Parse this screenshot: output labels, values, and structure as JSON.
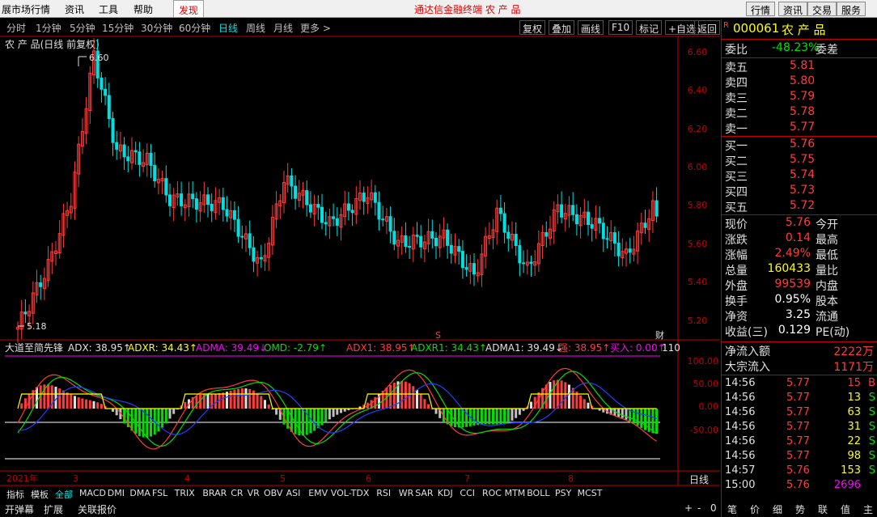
{
  "menu": [
    "展市场行情",
    "资讯",
    "工具",
    "帮助",
    "发现"
  ],
  "center_title": "通达信金融终端   农 产 品",
  "right_buttons": [
    "行情",
    "资讯",
    "交易",
    "服务"
  ],
  "periods": [
    "分时",
    "1分钟",
    "5分钟",
    "15分钟",
    "30分钟",
    "60分钟",
    "日线",
    "周线",
    "月线",
    "更多 >"
  ],
  "active_period": "日线",
  "tools": [
    "复权",
    "叠加",
    "画线",
    "F10",
    "标记",
    "+自选",
    "返回"
  ],
  "stock_title": "农 产 品(日线 前复权)",
  "price_axis": [
    "6.60",
    "6.40",
    "6.20",
    "6.00",
    "5.80",
    "5.60",
    "5.40",
    "5.20"
  ],
  "high_label": "6.60",
  "low_label": "5.18",
  "indicator_legend": {
    "name": "大道至简先锋",
    "adx": "ADX: 38.95↑",
    "adxr": "ADXR: 34.43↑",
    "adma": "ADMA: 39.49↓",
    "omd": "OMD: -2.79↑",
    "adx1": "ADX1: 38.95↑",
    "adxr1": "ADXR1: 34.43↑",
    "adma1": "ADMA1: 39.49↓",
    "qiang": "强: 38.95↑",
    "mairu": "买入: 0.00↑",
    "extra": "110"
  },
  "ind_axis": [
    "100.00",
    "50.00",
    "0.00",
    "-50.00"
  ],
  "date_labels": [
    "2021年",
    "3",
    "4",
    "5",
    "6",
    "7",
    "8"
  ],
  "period_label": "日线",
  "indicator_tabs": [
    "指标",
    "模板",
    "全部",
    "MACD",
    "DMI",
    "DMA",
    "FSL",
    "TRIX",
    "BRAR",
    "CR",
    "VR",
    "OBV",
    "ASI",
    "EMV",
    "VOL-TDX",
    "RSI",
    "WR",
    "SAR",
    "KDJ",
    "CCI",
    "ROC",
    "MTM",
    "BOLL",
    "PSY",
    "MCST"
  ],
  "bottom_left": [
    "开弹幕",
    "扩展",
    "关联报价"
  ],
  "scroll_controls": [
    "+",
    "-",
    "0"
  ],
  "quote": {
    "code": "000061",
    "name": "农 产 品",
    "weibi_label": "委比",
    "weibi": "-48.23%",
    "weicha_label": "委差",
    "asks": [
      {
        "label": "卖五",
        "price": "5.81"
      },
      {
        "label": "卖四",
        "price": "5.80"
      },
      {
        "label": "卖三",
        "price": "5.79"
      },
      {
        "label": "卖二",
        "price": "5.78"
      },
      {
        "label": "卖一",
        "price": "5.77"
      }
    ],
    "bids": [
      {
        "label": "买一",
        "price": "5.76"
      },
      {
        "label": "买二",
        "price": "5.75"
      },
      {
        "label": "买三",
        "price": "5.74"
      },
      {
        "label": "买四",
        "price": "5.73"
      },
      {
        "label": "买五",
        "price": "5.72"
      }
    ],
    "stats": [
      {
        "l1": "现价",
        "v1": "5.76",
        "c1": "red",
        "l2": "今开"
      },
      {
        "l1": "涨跌",
        "v1": "0.14",
        "c1": "red",
        "l2": "最高"
      },
      {
        "l1": "涨幅",
        "v1": "2.49%",
        "c1": "red",
        "l2": "最低"
      },
      {
        "l1": "总量",
        "v1": "160433",
        "c1": "yel",
        "l2": "量比"
      },
      {
        "l1": "外盘",
        "v1": "99539",
        "c1": "red",
        "l2": "内盘"
      },
      {
        "l1": "换手",
        "v1": "0.95%",
        "c1": "wht",
        "l2": "股本"
      },
      {
        "l1": "净资",
        "v1": "3.25",
        "c1": "wht",
        "l2": "流通"
      },
      {
        "l1": "收益(三)",
        "v1": "0.129",
        "c1": "wht",
        "l2": "PE(动)"
      }
    ],
    "flows": [
      {
        "label": "净流入额",
        "value": "2222万"
      },
      {
        "label": "大宗流入",
        "value": "1171万"
      }
    ],
    "ticks": [
      {
        "time": "14:56",
        "price": "5.77",
        "vol": "15",
        "flag": "B"
      },
      {
        "time": "14:56",
        "price": "5.77",
        "vol": "13",
        "flag": "S"
      },
      {
        "time": "14:56",
        "price": "5.77",
        "vol": "63",
        "flag": "S"
      },
      {
        "time": "14:56",
        "price": "5.77",
        "vol": "31",
        "flag": "S"
      },
      {
        "time": "14:56",
        "price": "5.77",
        "vol": "22",
        "flag": "S"
      },
      {
        "time": "14:56",
        "price": "5.77",
        "vol": "98",
        "flag": "S"
      },
      {
        "time": "14:57",
        "price": "5.76",
        "vol": "153",
        "flag": "S"
      },
      {
        "time": "15:00",
        "price": "5.76",
        "vol": "2696",
        "flag": ""
      }
    ],
    "side_tabs": [
      "笔",
      "价",
      "细",
      "势",
      "联",
      "值",
      "主"
    ]
  },
  "colors": {
    "up": "#ff3c3c",
    "down": "#00e0e0",
    "frame": "#c00000"
  }
}
